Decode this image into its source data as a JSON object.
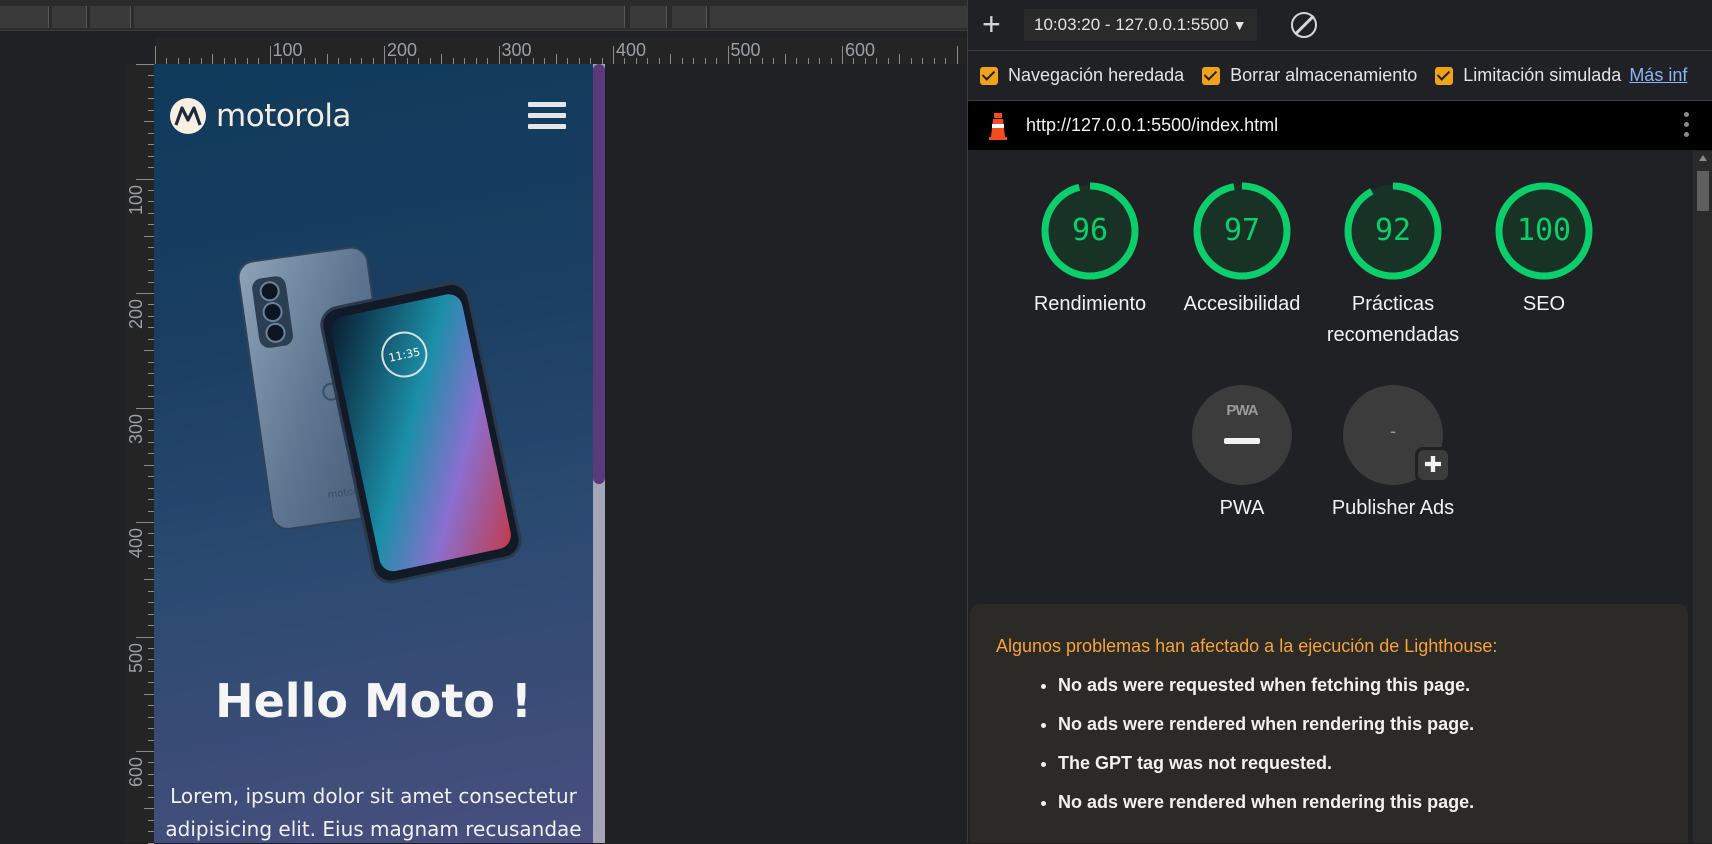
{
  "viewport": {
    "ruler_h_labels": [
      "100",
      "200",
      "300",
      "400",
      "500",
      "600"
    ],
    "ruler_v_labels": [
      "100",
      "200",
      "300",
      "400",
      "500",
      "600"
    ],
    "site": {
      "brand": "motorola",
      "heading": "Hello Moto !",
      "body_lines": [
        "Lorem, ipsum dolor sit amet consectetur",
        "adipisicing elit. Eius magnam recusandae"
      ],
      "clock": "11:35",
      "phone_back_brand": "motorola"
    }
  },
  "devtools": {
    "run_select": "10:03:20 - 127.0.0.1:5500",
    "options": [
      {
        "label": "Navegación heredada",
        "checked": true
      },
      {
        "label": "Borrar almacenamiento",
        "checked": true
      },
      {
        "label": "Limitación simulada",
        "checked": true
      }
    ],
    "more_link": "Más inf",
    "url": "http://127.0.0.1:5500/index.html",
    "gauges": [
      {
        "score": "96",
        "value": 96,
        "label": "Rendimiento"
      },
      {
        "score": "97",
        "value": 97,
        "label": "Accesibilidad"
      },
      {
        "score": "92",
        "value": 92,
        "label": "Prácticas recomendadas"
      },
      {
        "score": "100",
        "value": 100,
        "label": "SEO"
      }
    ],
    "pwa": {
      "badge": "PWA",
      "label": "PWA"
    },
    "publisher": {
      "score": "-",
      "label": "Publisher Ads"
    },
    "warning": {
      "title": "Algunos problemas han afectado a la ejecución de Lighthouse:",
      "items": [
        "No ads were requested when fetching this page.",
        "No ads were rendered when rendering this page.",
        "The GPT tag was not requested.",
        "No ads were rendered when rendering this page."
      ]
    },
    "colors": {
      "pass": "#0cce6b",
      "warning": "#f7a23b",
      "checkbox": "#f0a21b"
    }
  }
}
